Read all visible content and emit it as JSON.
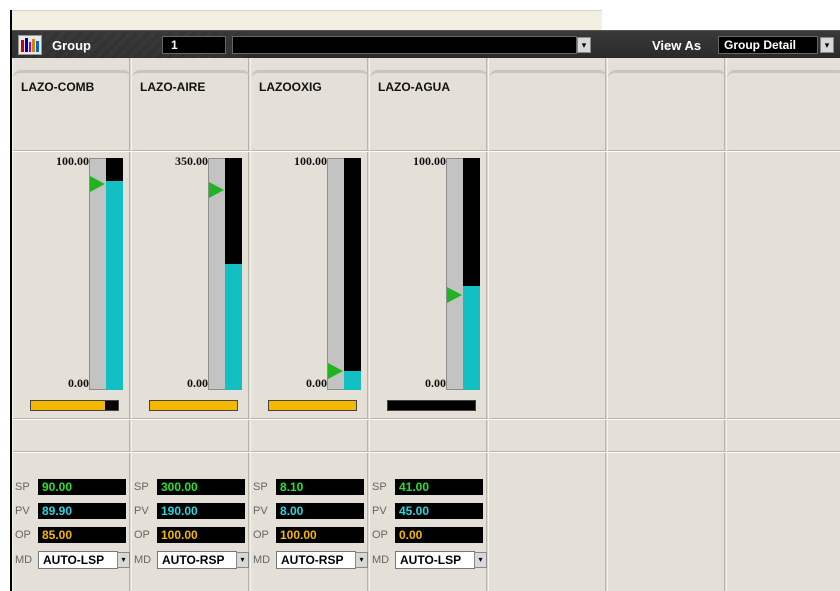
{
  "header": {
    "group_label": "Group",
    "group_number": "1",
    "group_name": "",
    "view_as_label": "View As",
    "view_as_value": "Group Detail",
    "dropdown_glyph": "▾"
  },
  "loops": [
    {
      "tag": "LAZO-COMB",
      "range_max": "100.00",
      "range_min": "0.00",
      "sp_pct": 89,
      "pv_pct": 89.9,
      "op_pct": 85,
      "sp_label": "SP",
      "pv_label": "PV",
      "op_label": "OP",
      "md_label": "MD",
      "sp": "90.00",
      "pv": "89.90",
      "op": "85.00",
      "mode": "AUTO-LSP"
    },
    {
      "tag": "LAZO-AIRE",
      "range_max": "350.00",
      "range_min": "0.00",
      "sp_pct": 86,
      "pv_pct": 54.3,
      "op_pct": 100,
      "sp_label": "SP",
      "pv_label": "PV",
      "op_label": "OP",
      "md_label": "MD",
      "sp": "300.00",
      "pv": "190.00",
      "op": "100.00",
      "mode": "AUTO-RSP"
    },
    {
      "tag": "LAZOOXIG",
      "range_max": "100.00",
      "range_min": "0.00",
      "sp_pct": 8.1,
      "pv_pct": 8,
      "op_pct": 100,
      "sp_label": "SP",
      "pv_label": "PV",
      "op_label": "OP",
      "md_label": "MD",
      "sp": "8.10",
      "pv": "8.00",
      "op": "100.00",
      "mode": "AUTO-RSP"
    },
    {
      "tag": "LAZO-AGUA",
      "range_max": "100.00",
      "range_min": "0.00",
      "sp_pct": 41,
      "pv_pct": 45,
      "op_pct": 0,
      "sp_label": "SP",
      "pv_label": "PV",
      "op_label": "OP",
      "md_label": "MD",
      "sp": "41.00",
      "pv": "45.00",
      "op": "0.00",
      "mode": "AUTO-LSP"
    }
  ],
  "colors": {
    "sp": "#2ee02e",
    "pv": "#27d7e0",
    "op": "#f5b800",
    "bar_pv": "#12bfc2",
    "sp_arrow": "#22b322"
  }
}
